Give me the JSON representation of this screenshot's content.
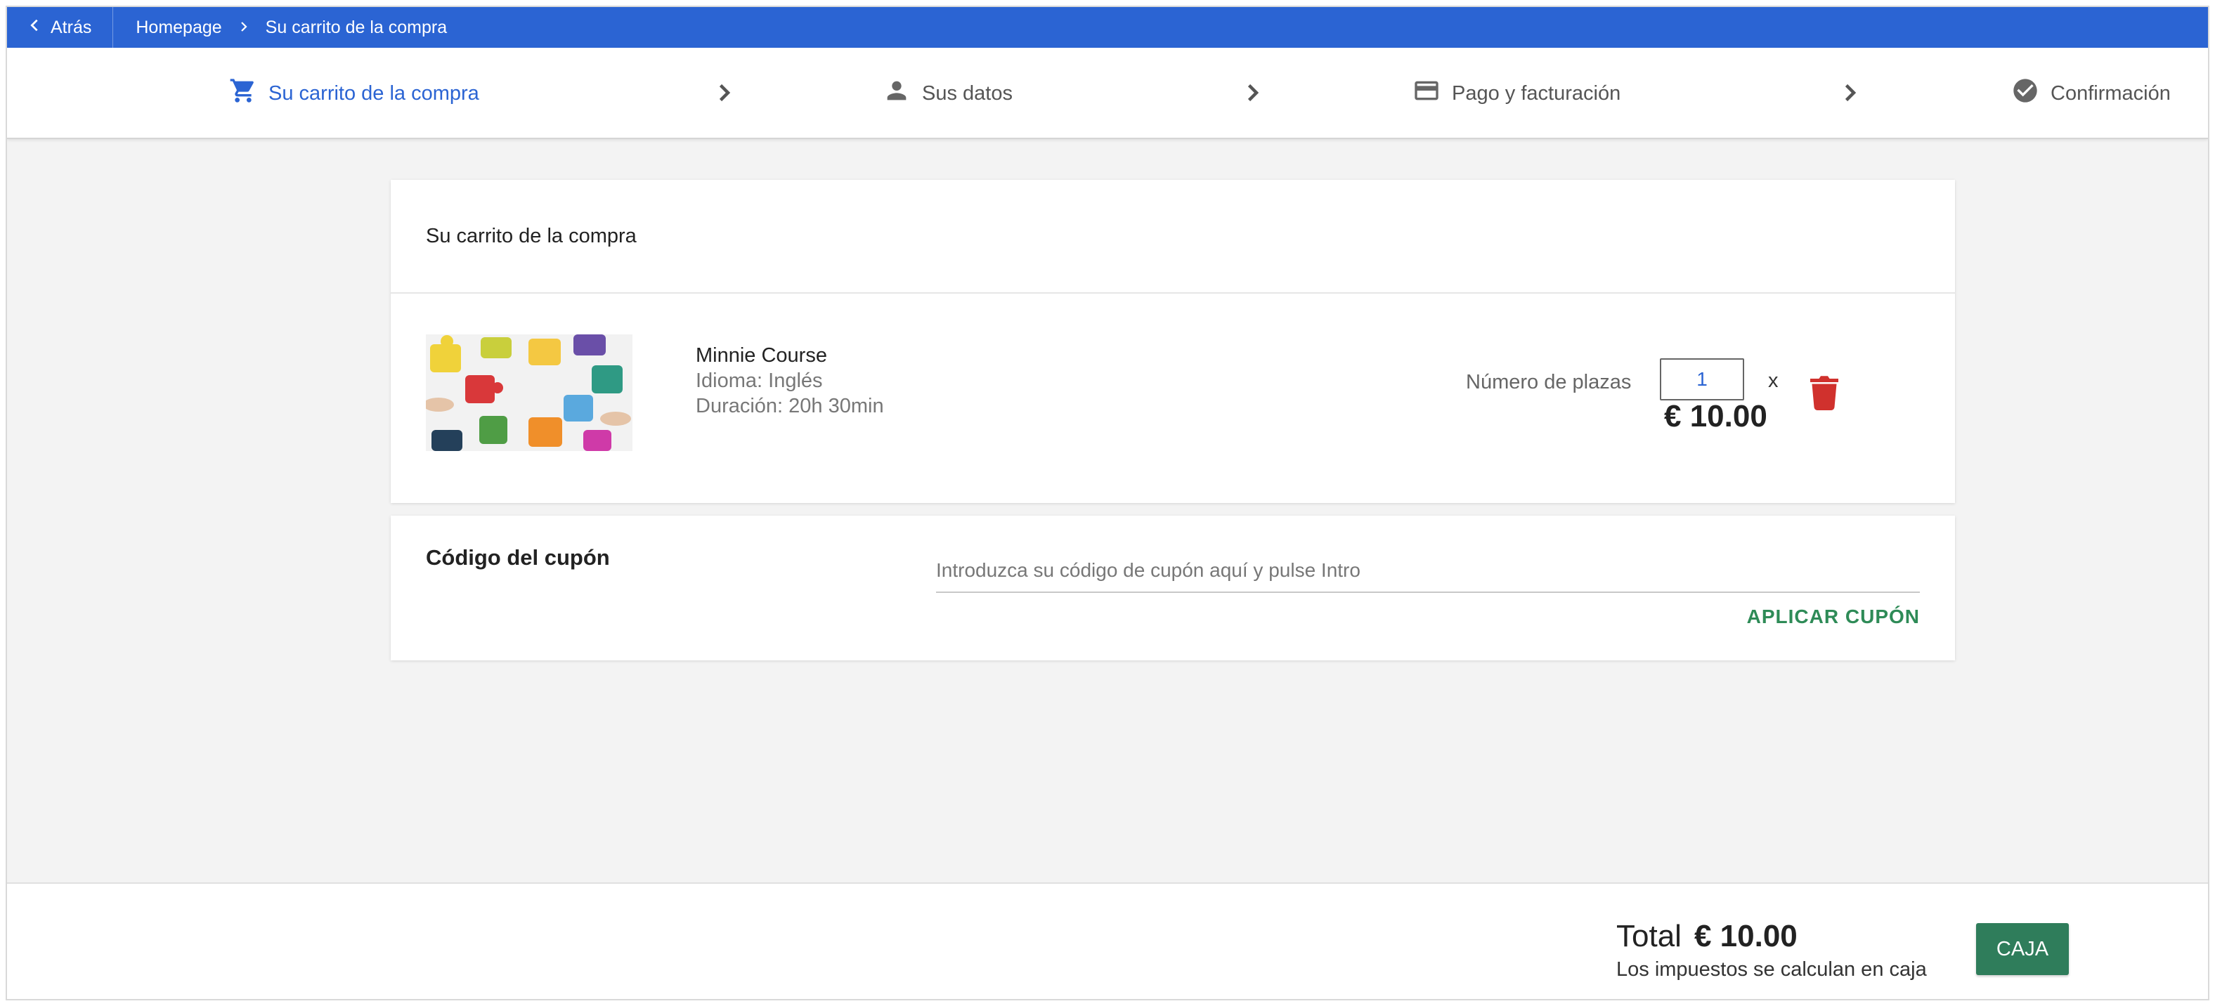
{
  "topbar": {
    "back_label": "Atrás",
    "breadcrumbs": [
      "Homepage",
      "Su carrito de la compra"
    ],
    "color": "#2b64d3"
  },
  "stepper": {
    "steps": [
      {
        "label": "Su carrito de la compra",
        "icon": "cart-icon",
        "active": true
      },
      {
        "label": "Sus datos",
        "icon": "person-icon",
        "active": false
      },
      {
        "label": "Pago y facturación",
        "icon": "credit-card-icon",
        "active": false
      },
      {
        "label": "Confirmación",
        "icon": "check-circle-icon",
        "active": false
      }
    ],
    "active_color": "#2b64d3"
  },
  "cart": {
    "heading": "Su carrito de la compra",
    "item": {
      "image": "puzzle-pieces-image",
      "title": "Minnie Course",
      "language": "Idioma: Inglés",
      "duration": "Duración: 20h 30min",
      "seats_label": "Número de plazas",
      "quantity": "1",
      "times": "x",
      "price": "€ 10.00",
      "delete_icon": "trash-icon",
      "delete_color": "#d0312d"
    }
  },
  "coupon": {
    "title": "Código del cupón",
    "placeholder": "Introduzca su código de cupón aquí y pulse Intro",
    "apply_label": "APLICAR CUPÓN",
    "apply_color": "#2e8b57"
  },
  "footer": {
    "total_label": "Total",
    "total_value": "€ 10.00",
    "tax_note": "Los impuestos se calculan en caja",
    "checkout_label": "CAJA",
    "checkout_color": "#2f7d5b"
  }
}
